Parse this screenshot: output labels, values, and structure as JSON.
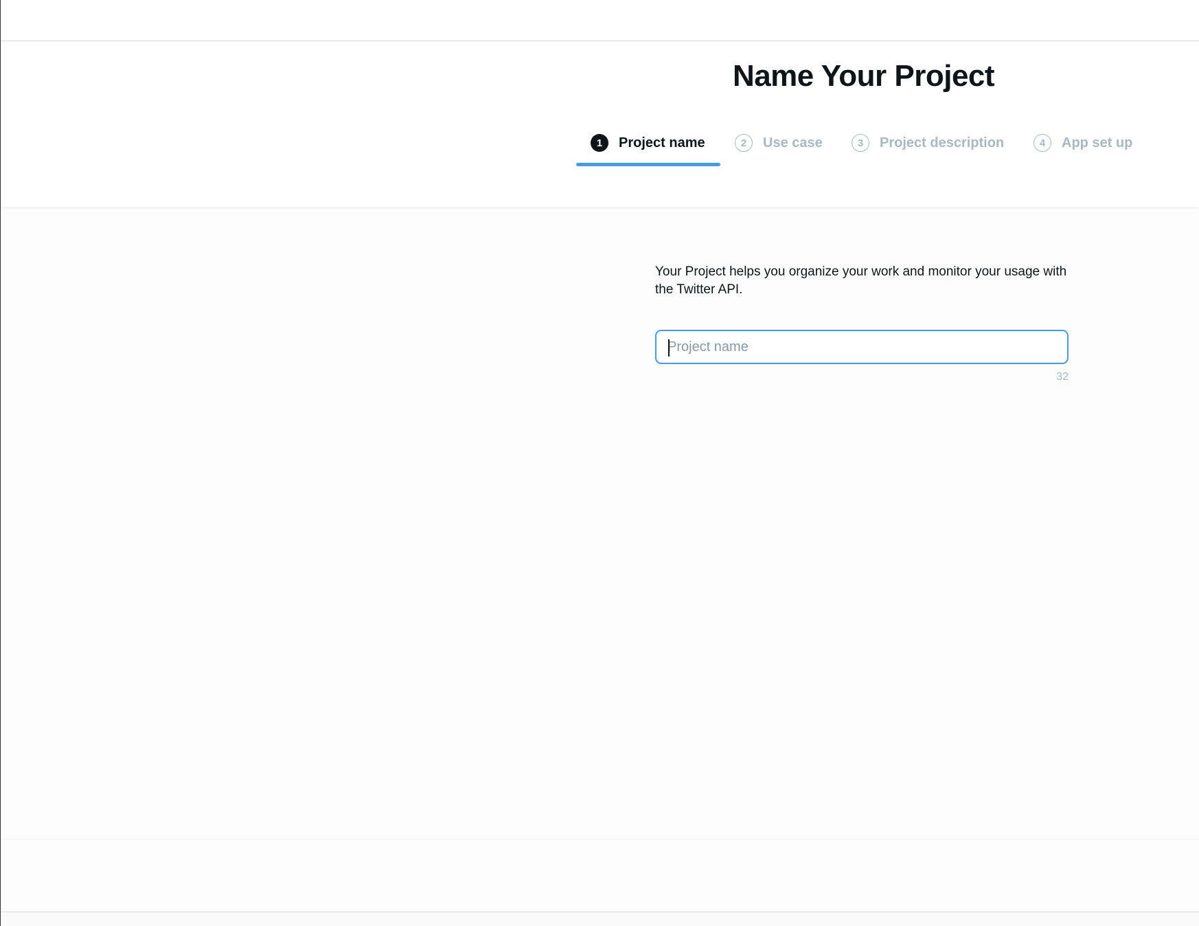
{
  "header": {
    "title": "Name Your Project"
  },
  "stepper": {
    "steps": [
      {
        "number": "1",
        "label": "Project name",
        "state": "active"
      },
      {
        "number": "2",
        "label": "Use case",
        "state": "inactive"
      },
      {
        "number": "3",
        "label": "Project description",
        "state": "inactive"
      },
      {
        "number": "4",
        "label": "App set up",
        "state": "inactive"
      }
    ]
  },
  "main": {
    "intro": "Your Project helps you organize your work and monitor your usage with the Twitter API.",
    "project_name_input": {
      "value": "",
      "placeholder": "Project name"
    },
    "char_count": "32"
  },
  "colors": {
    "accent": "#4a99e9",
    "text_primary": "#0f1419",
    "text_muted": "#aab8c2"
  }
}
